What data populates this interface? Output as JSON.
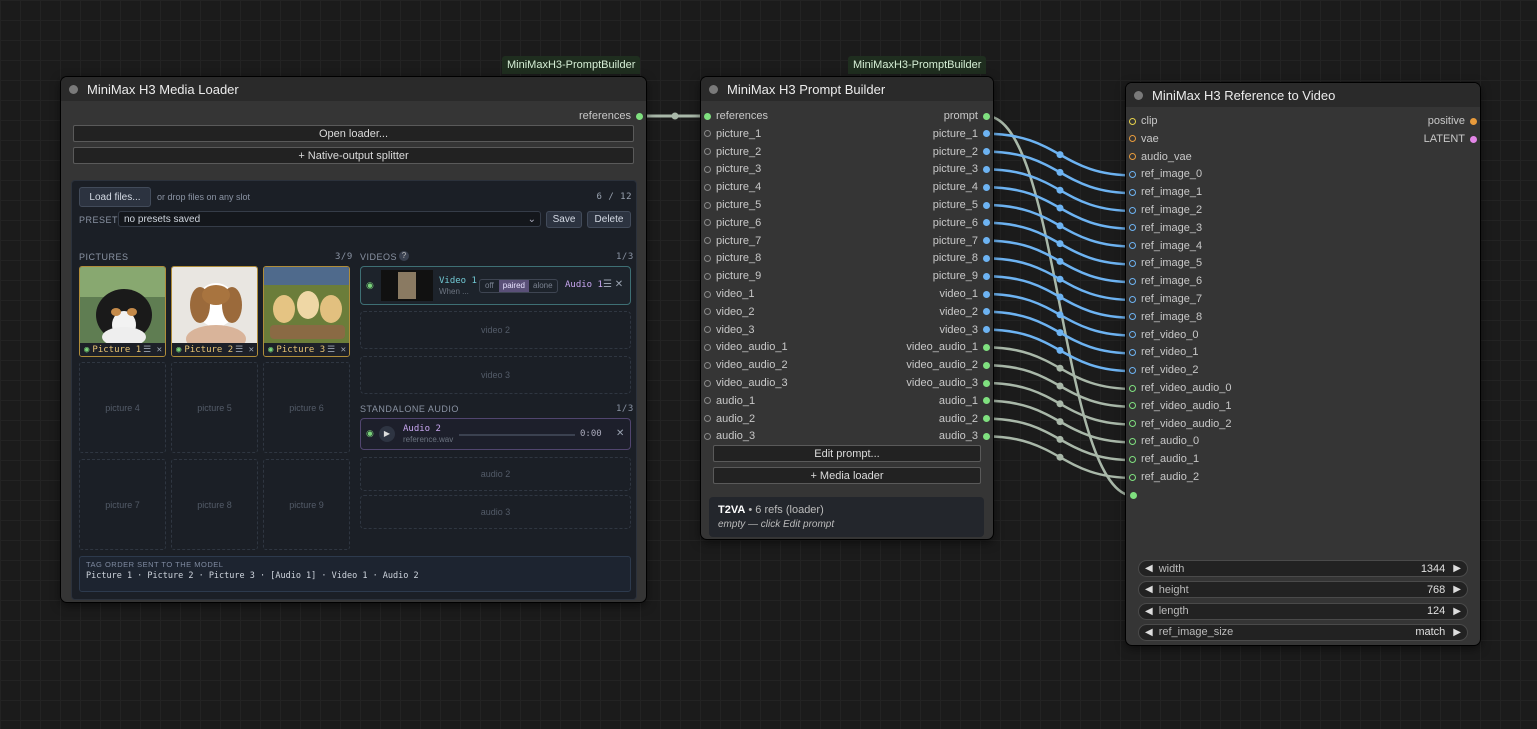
{
  "badges": {
    "loader": "MiniMaxH3-PromptBuilder",
    "builder": "MiniMaxH3-PromptBuilder"
  },
  "loader": {
    "title": "MiniMax H3 Media Loader",
    "output": "references",
    "open_btn": "Open loader...",
    "splitter_btn": "+ Native-output splitter",
    "load_btn": "Load files...",
    "drop_hint": "or drop files on any slot",
    "count": "6 / 12",
    "preset_label": "PRESET",
    "preset_value": "no presets saved",
    "save_btn": "Save",
    "delete_btn": "Delete",
    "pictures_label": "PICTURES",
    "pictures_count": "3/9",
    "pictures": [
      "Picture 1",
      "Picture 2",
      "Picture 3"
    ],
    "picture_slots": [
      "picture 4",
      "picture 5",
      "picture 6",
      "picture 7",
      "picture 8",
      "picture 9"
    ],
    "videos_label": "VIDEOS",
    "videos_help": "?",
    "videos_count": "1/3",
    "video1": {
      "name": "Video 1",
      "sub": "When ...",
      "off": "off",
      "paired": "paired",
      "alone": "alone",
      "audio": "Audio 1"
    },
    "video_slots": [
      "video 2",
      "video 3"
    ],
    "audio_label": "STANDALONE AUDIO",
    "audio_count": "1/3",
    "audio1": {
      "name": "Audio 2",
      "file": "reference.wav",
      "time": "0:00"
    },
    "audio_slots": [
      "audio 2",
      "audio 3"
    ],
    "tag_label": "TAG ORDER SENT TO THE MODEL",
    "tag_order": "Picture 1 · Picture 2 · Picture 3 · [Audio 1] · Video 1 · Audio 2"
  },
  "builder": {
    "title": "MiniMax H3 Prompt Builder",
    "inputs": [
      "references",
      "picture_1",
      "picture_2",
      "picture_3",
      "picture_4",
      "picture_5",
      "picture_6",
      "picture_7",
      "picture_8",
      "picture_9",
      "video_1",
      "video_2",
      "video_3",
      "video_audio_1",
      "video_audio_2",
      "video_audio_3",
      "audio_1",
      "audio_2",
      "audio_3"
    ],
    "outputs": [
      "prompt",
      "picture_1",
      "picture_2",
      "picture_3",
      "picture_4",
      "picture_5",
      "picture_6",
      "picture_7",
      "picture_8",
      "picture_9",
      "video_1",
      "video_2",
      "video_3",
      "video_audio_1",
      "video_audio_2",
      "video_audio_3",
      "audio_1",
      "audio_2",
      "audio_3"
    ],
    "edit_btn": "Edit prompt...",
    "media_btn": "+ Media loader",
    "mode": "T2VA",
    "mode_detail": "• 6 refs (loader)",
    "empty_hint": "empty — click Edit prompt"
  },
  "r2v": {
    "title": "MiniMax H3 Reference to Video",
    "inputs": [
      "clip",
      "vae",
      "audio_vae",
      "ref_image_0",
      "ref_image_1",
      "ref_image_2",
      "ref_image_3",
      "ref_image_4",
      "ref_image_5",
      "ref_image_6",
      "ref_image_7",
      "ref_image_8",
      "ref_video_0",
      "ref_video_1",
      "ref_video_2",
      "ref_video_audio_0",
      "ref_video_audio_1",
      "ref_video_audio_2",
      "ref_audio_0",
      "ref_audio_1",
      "ref_audio_2"
    ],
    "outputs": [
      "positive",
      "LATENT"
    ],
    "widgets": [
      {
        "label": "width",
        "value": "1344"
      },
      {
        "label": "height",
        "value": "768"
      },
      {
        "label": "length",
        "value": "124"
      },
      {
        "label": "ref_image_size",
        "value": "match"
      }
    ]
  },
  "colors": {
    "image_wire": "#6db3f2",
    "audio_wire": "#a9b8a9",
    "int_wire": "#7fe07f"
  }
}
